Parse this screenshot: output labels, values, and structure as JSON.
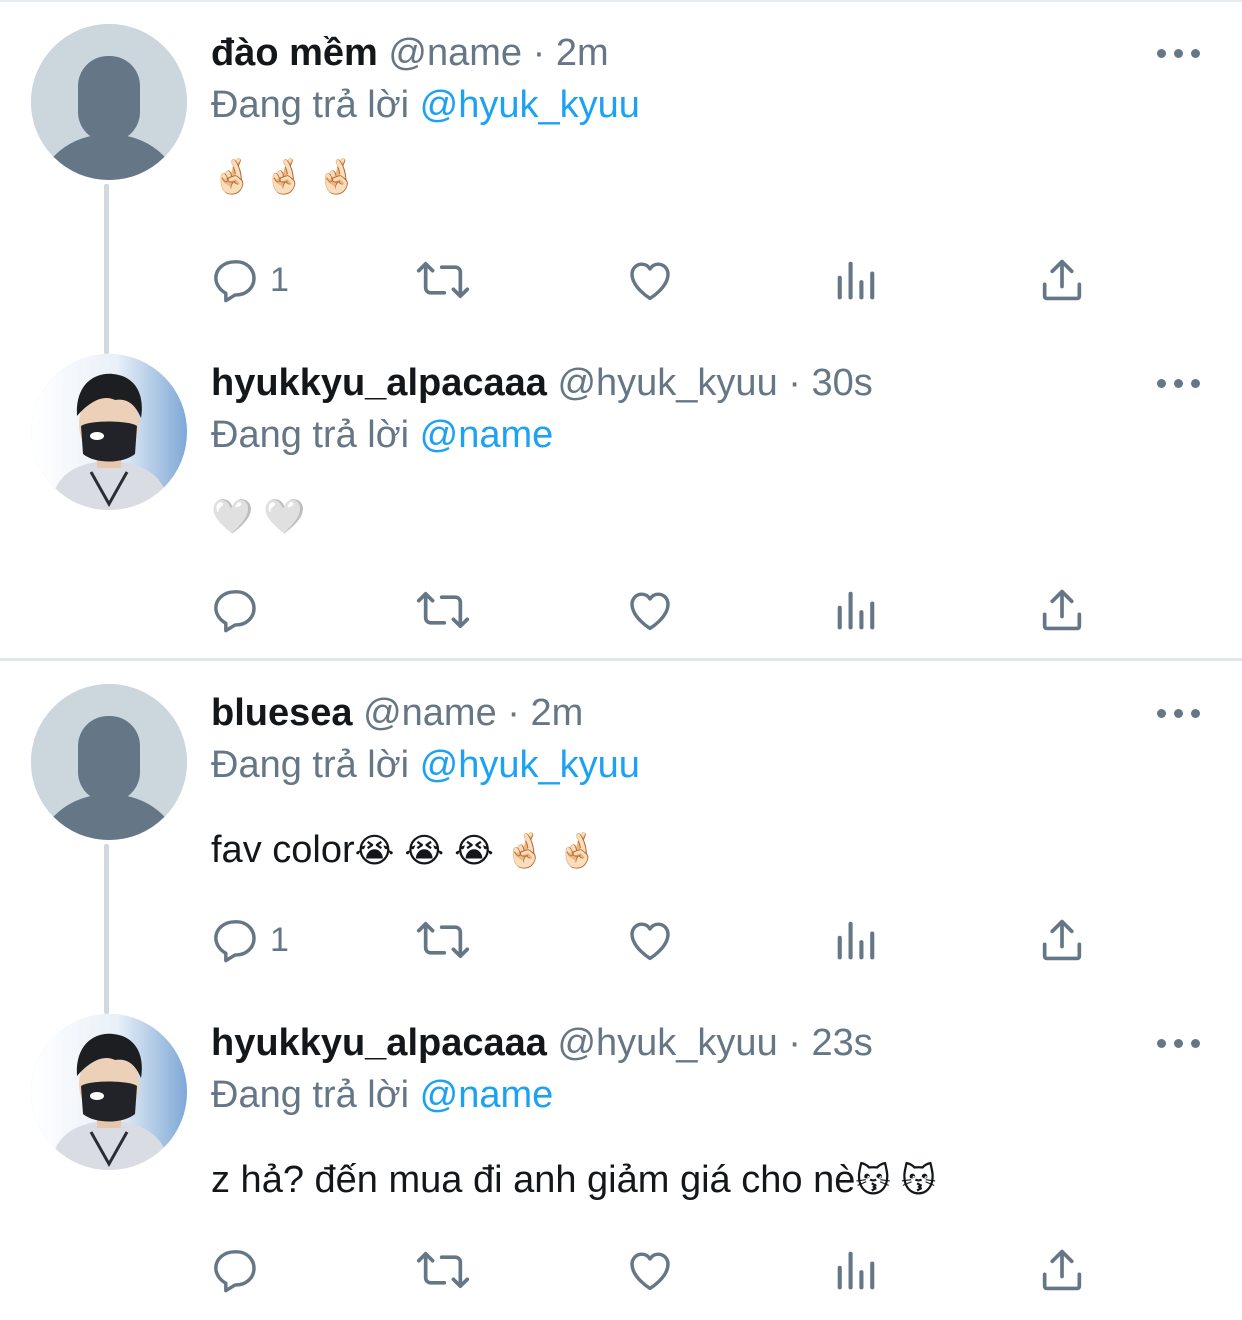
{
  "threads": [
    {
      "parent": {
        "name": "đào mềm",
        "handle": "@name",
        "separator": "·",
        "time": "2m",
        "replying_prefix": "Đang trả lời",
        "replying_to": "@hyuk_kyuu",
        "text": "",
        "emojis": [
          "🤞🏻",
          "🤞🏻",
          "🤞🏻"
        ],
        "reply_count": "1"
      },
      "reply": {
        "name": "hyukkyu_alpacaaa",
        "handle": "@hyuk_kyuu",
        "separator": "·",
        "time": "30s",
        "replying_prefix": "Đang trả lời",
        "replying_to": "@name",
        "text": "",
        "emojis": [
          "🤍",
          "🤍"
        ],
        "reply_count": ""
      }
    },
    {
      "parent": {
        "name": "bluesea",
        "handle": "@name",
        "separator": "·",
        "time": "2m",
        "replying_prefix": "Đang trả lời",
        "replying_to": "@hyuk_kyuu",
        "text": "fav color",
        "emojis": [
          "😭",
          "😭",
          "😭",
          "🤞🏻",
          "🤞🏻"
        ],
        "reply_count": "1"
      },
      "reply": {
        "name": "hyukkyu_alpacaaa",
        "handle": "@hyuk_kyuu",
        "separator": "·",
        "time": "23s",
        "replying_prefix": "Đang trả lời",
        "replying_to": "@name",
        "text": "z hả? đến mua đi anh giảm giá cho nè",
        "emojis": [
          "😽",
          "😽"
        ],
        "reply_count": ""
      }
    }
  ],
  "icons": {
    "reply": "reply-icon",
    "retweet": "retweet-icon",
    "like": "heart-icon",
    "views": "analytics-icon",
    "share": "share-icon",
    "more": "more-icon"
  },
  "colors": {
    "text": "#14171a",
    "secondary": "#657786",
    "link": "#1da1f2",
    "divider": "#e1e8ed",
    "thread_line": "#cfd9de",
    "default_avatar_bg": "#ccd6dd",
    "default_avatar_fg": "#657786"
  }
}
